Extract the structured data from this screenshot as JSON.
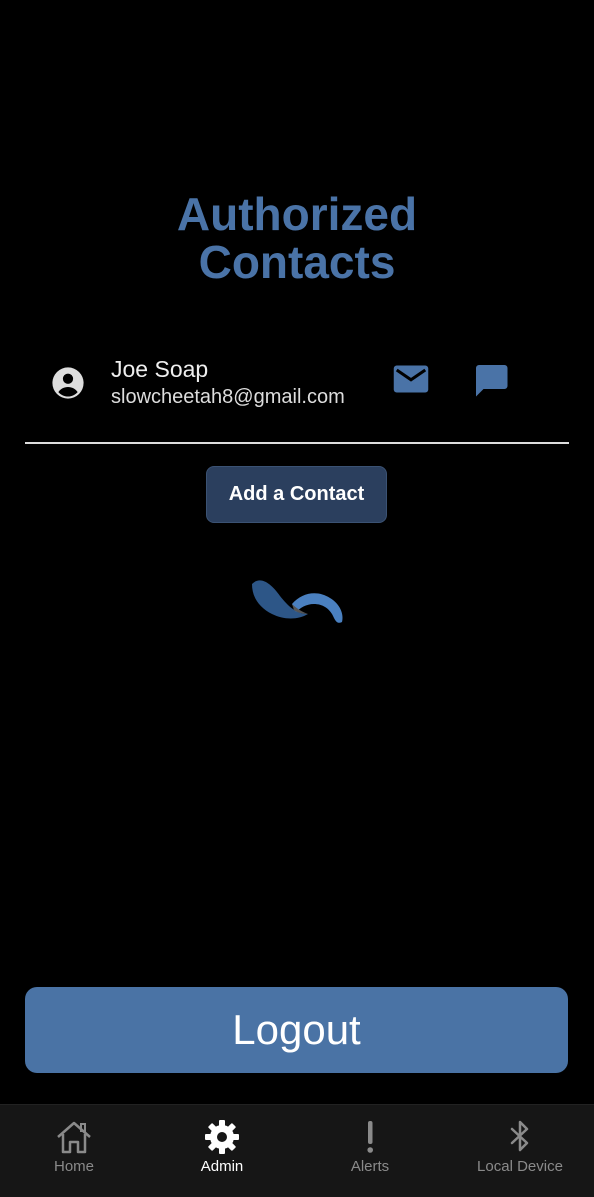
{
  "page": {
    "title_line1": "Authorized",
    "title_line2": "Contacts"
  },
  "contacts": [
    {
      "name": "Joe Soap",
      "email": "slowcheetah8@gmail.com",
      "avatar_icon": "account-circle-icon",
      "actions": [
        "email-icon",
        "message-icon"
      ]
    }
  ],
  "actions": {
    "add_contact_label": "Add a Contact",
    "logout_label": "Logout"
  },
  "loading_indicator": "spinner-icon",
  "tabbar": {
    "tabs": [
      {
        "label": "Home",
        "icon": "home-icon",
        "active": false
      },
      {
        "label": "Admin",
        "icon": "gear-icon",
        "active": true
      },
      {
        "label": "Alerts",
        "icon": "exclamation-icon",
        "active": false
      },
      {
        "label": "Local Device",
        "icon": "bluetooth-icon",
        "active": false
      }
    ]
  },
  "colors": {
    "background": "#000000",
    "title": "#4a73a7",
    "accent_icon": "#4a73a7",
    "add_button": "#2b3f5e",
    "logout_button": "#4a73a5",
    "tabbar": "#161616"
  }
}
